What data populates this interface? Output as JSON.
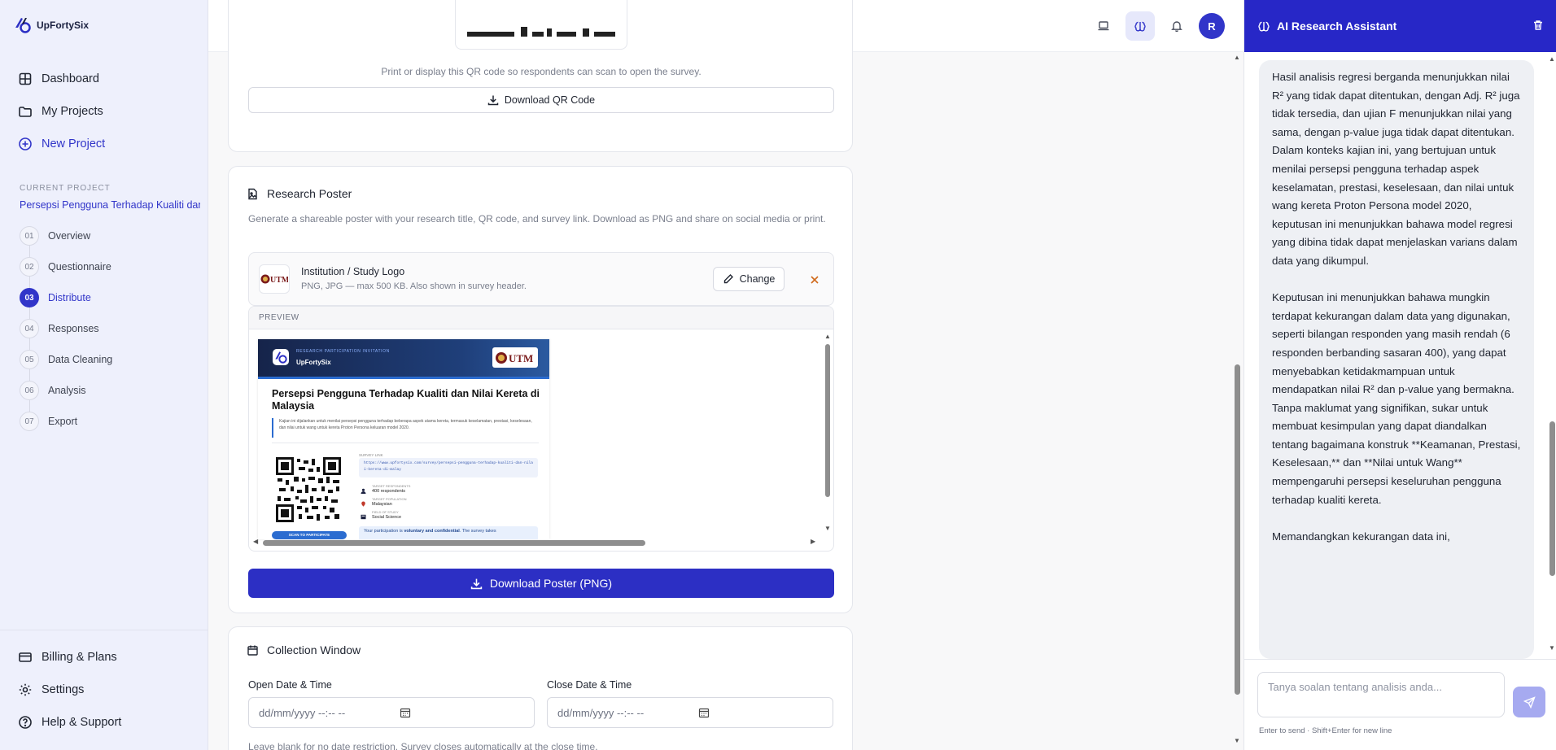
{
  "brand": {
    "name": "UpFortySix"
  },
  "sidebar": {
    "nav": [
      {
        "label": "Dashboard",
        "icon": "grid-icon"
      },
      {
        "label": "My Projects",
        "icon": "folder-icon"
      },
      {
        "label": "New Project",
        "icon": "plus-circle-icon"
      }
    ],
    "current_project_label": "CURRENT PROJECT",
    "current_project_name": "Persepsi Pengguna Terhadap Kualiti dan",
    "steps": [
      {
        "num": "01",
        "label": "Overview"
      },
      {
        "num": "02",
        "label": "Questionnaire"
      },
      {
        "num": "03",
        "label": "Distribute",
        "active": true
      },
      {
        "num": "04",
        "label": "Responses"
      },
      {
        "num": "05",
        "label": "Data Cleaning"
      },
      {
        "num": "06",
        "label": "Analysis"
      },
      {
        "num": "07",
        "label": "Export"
      }
    ],
    "footer": [
      {
        "label": "Billing & Plans",
        "icon": "credit-card-icon"
      },
      {
        "label": "Settings",
        "icon": "gear-icon"
      },
      {
        "label": "Help & Support",
        "icon": "help-circle-icon"
      }
    ]
  },
  "header": {
    "avatar_initial": "R"
  },
  "qr_card": {
    "hint": "Print or display this QR code so respondents can scan to open the survey.",
    "download_label": "Download QR Code"
  },
  "poster_card": {
    "title": "Research Poster",
    "description": "Generate a shareable poster with your research title, QR code, and survey link. Download as PNG and share on social media or print.",
    "logo_title": "Institution / Study Logo",
    "logo_sub": "PNG, JPG — max 500 KB. Also shown in survey header.",
    "change_label": "Change",
    "preview_label": "PREVIEW",
    "download_label": "Download Poster (PNG)",
    "poster": {
      "kicker": "RESEARCH PARTICIPATION INVITATION",
      "brand": "UpFortySix",
      "logo_text": "UTM",
      "title": "Persepsi Pengguna Terhadap Kualiti dan Nilai Kereta di Malaysia",
      "summary": "Kajian ini dijalankan untuk menilai persepsi pengguna terhadap beberapa aspek utama kereta, termasuk keselamatan, prestasi, keselesaan, dan nilai untuk wang untuk kereta Proton Persona keluaran model 2020.",
      "survey_link_label": "SURVEY LINK",
      "survey_link": "https://www.upfortysix.com/survey/persepsi-pengguna-terhadap-kualiti-dan-nilai-kereta-di-malay",
      "target_label": "TARGET RESPONDENTS",
      "target_value": "400 respondents",
      "population_label": "TARGET POPULATION",
      "population_value": "Malaysian",
      "field_label": "FIELD OF STUDY",
      "field_value": "Social Science",
      "scan_label": "SCAN TO PARTICIPATE",
      "note_prefix": "Your participation is ",
      "note_bold": "voluntary and confidential",
      "note_suffix": ". The survey takes"
    }
  },
  "collection_card": {
    "title": "Collection Window",
    "open_label": "Open Date & Time",
    "close_label": "Close Date & Time",
    "open_placeholder": "dd/mm/yyyy --:-- --",
    "close_placeholder": "dd/mm/yyyy --:-- --",
    "note": "Leave blank for no date restriction. Survey closes automatically at the close time."
  },
  "assistant": {
    "title": "AI Research Assistant",
    "message": "Hasil analisis regresi berganda menunjukkan nilai R² yang tidak dapat ditentukan, dengan Adj. R² juga tidak tersedia, dan ujian F menunjukkan nilai yang sama, dengan p-value juga tidak dapat ditentukan. Dalam konteks kajian ini, yang bertujuan untuk menilai persepsi pengguna terhadap aspek keselamatan, prestasi, keselesaan, dan nilai untuk wang kereta Proton Persona model 2020, keputusan ini menunjukkan bahawa model regresi yang dibina tidak dapat menjelaskan varians dalam data yang dikumpul.\n\nKeputusan ini menunjukkan bahawa mungkin terdapat kekurangan dalam data yang digunakan, seperti bilangan responden yang masih rendah (6 responden berbanding sasaran 400), yang dapat menyebabkan ketidakmampuan untuk mendapatkan nilai R² dan p-value yang bermakna. Tanpa maklumat yang signifikan, sukar untuk membuat kesimpulan yang dapat diandalkan tentang bagaimana konstruk **Keamanan, Prestasi, Keselesaan,** dan **Nilai untuk Wang** mempengaruhi persepsi keseluruhan pengguna terhadap kualiti kereta.\n\nMemandangkan kekurangan data ini,",
    "input_placeholder": "Tanya soalan tentang analisis anda...",
    "hint": "Enter to send · Shift+Enter for new line"
  },
  "colors": {
    "accent": "#3135c9",
    "panel_header": "#2727c7",
    "poster_navy": "#16244a"
  }
}
